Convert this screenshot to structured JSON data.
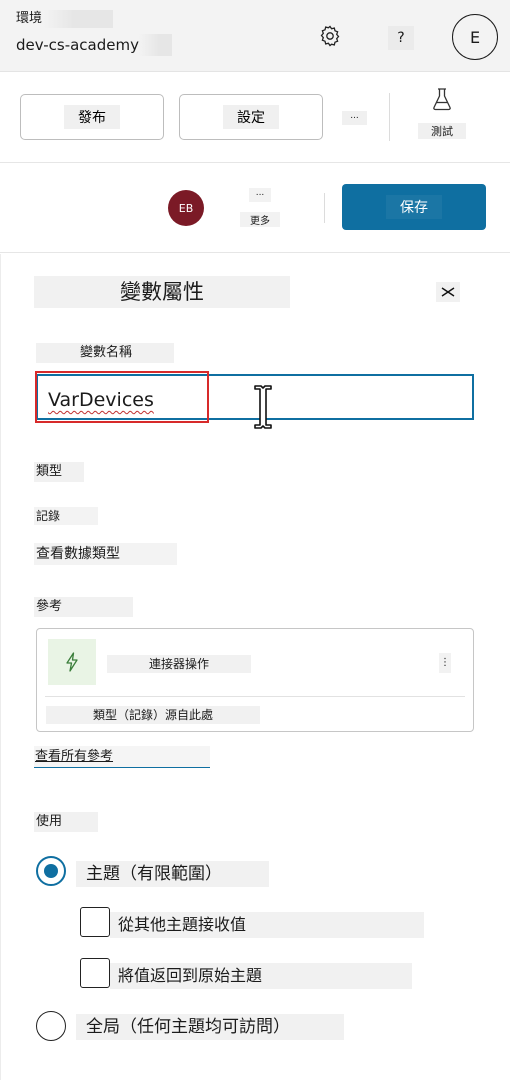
{
  "header": {
    "environment_label": "環境",
    "environment_name": "dev-cs-academy",
    "help_label": "?",
    "user_initial": "E"
  },
  "toolbar": {
    "publish_label": "發布",
    "settings_label": "設定",
    "more_label": "...",
    "test_label": "測試"
  },
  "actions": {
    "avatar_initials": "EB",
    "more_dots": "...",
    "more_label": "更多",
    "save_label": "保存"
  },
  "panel": {
    "title": "變數屬性",
    "variable_name_label": "變數名稱",
    "variable_name_value": "VarDevices",
    "type_label": "類型",
    "type_value": "記錄",
    "view_type_link": "查看數據類型",
    "reference_label": "參考",
    "reference": {
      "name": "連接器操作",
      "description": "類型（記錄）源自此處"
    },
    "view_all_references": "查看所有參考",
    "usage_label": "使用",
    "usage_options": {
      "topic": "主題（有限範圍）",
      "receive_from_other_topics": "從其他主題接收值",
      "return_to_original_topic": "將值返回到原始主題",
      "global": "全局（任何主題均可訪問）"
    },
    "selected_usage": "topic"
  },
  "colors": {
    "accent": "#0f6fa1",
    "avatar": "#7b1a26",
    "highlight_box": "#d72a2a",
    "connector_tile": "#e9f4e5",
    "connector_icon": "#3a7d3a"
  }
}
